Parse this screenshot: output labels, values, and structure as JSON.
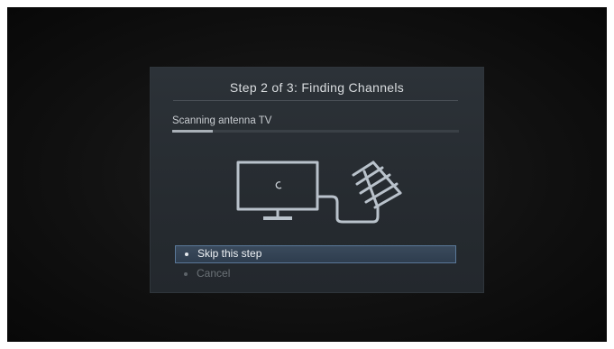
{
  "dialog": {
    "title": "Step 2 of 3: Finding Channels",
    "status_label": "Scanning antenna TV",
    "progress": 0.14,
    "illustration": "tv-antenna-scan",
    "menu": [
      {
        "label": "Skip this step",
        "selected": true
      },
      {
        "label": "Cancel",
        "selected": false
      }
    ]
  },
  "colors": {
    "accent_border": "#5a7898",
    "dialog_bg": "#2a3036",
    "icon_stroke": "#b9c2cb"
  }
}
